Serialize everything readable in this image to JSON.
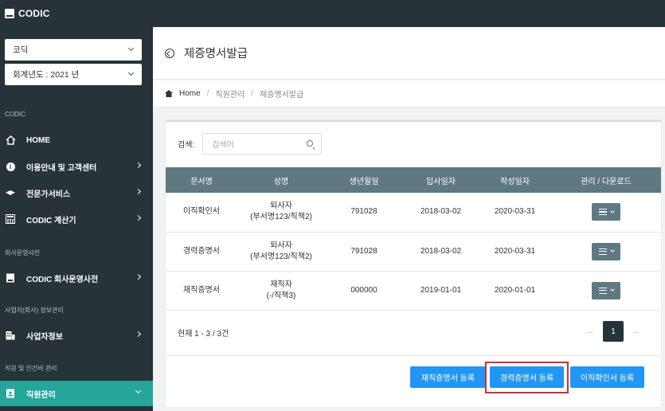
{
  "app": {
    "brand": "CODIC"
  },
  "sidebar": {
    "company_select": "코딕",
    "year_select": "회계년도 : 2021 년",
    "sections": [
      {
        "label": "CODIC"
      },
      {
        "label": "회사운영사전"
      },
      {
        "label": "사업자(회사) 정보관리"
      },
      {
        "label": "직원 및 인건비 관리"
      }
    ],
    "items": [
      {
        "label": "HOME",
        "icon": "home-icon"
      },
      {
        "label": "이용안내 및 고객센터",
        "icon": "info-icon"
      },
      {
        "label": "전문가서비스",
        "icon": "graduation-cap-icon"
      },
      {
        "label": "CODIC 계산기",
        "icon": "calculator-icon"
      },
      {
        "label": "CODIC 회사운영사전",
        "icon": "book-icon"
      },
      {
        "label": "사업자정보",
        "icon": "building-icon"
      },
      {
        "label": "직원관리",
        "icon": "id-card-icon"
      }
    ]
  },
  "page": {
    "title": "제증명서발급",
    "breadcrumb": [
      "Home",
      "직원관리",
      "제증명서발급"
    ]
  },
  "search": {
    "label": "검색:",
    "placeholder": "검색어"
  },
  "table": {
    "headers": [
      "문서명",
      "성명",
      "생년월일",
      "입사일자",
      "작성일자",
      "관리 / 다운로드"
    ],
    "rows": [
      {
        "doc": "이직확인서",
        "name": "퇴사자",
        "dept": "(부서명123/직책2)",
        "birth": "791028",
        "join": "2018-03-02",
        "written": "2020-03-31"
      },
      {
        "doc": "경력증명서",
        "name": "퇴사자",
        "dept": "(부서명123/직책2)",
        "birth": "791028",
        "join": "2018-03-02",
        "written": "2020-03-31"
      },
      {
        "doc": "재직증명서",
        "name": "재직자",
        "dept": "(-/직책3)",
        "birth": "000000",
        "join": "2019-01-01",
        "written": "2020-01-01"
      }
    ]
  },
  "pagination": {
    "summary": "현재 1 - 3 / 3건",
    "prev": "←",
    "current": "1",
    "next": "→"
  },
  "actions": {
    "employment_cert": "재직증명서 등록",
    "career_cert": "경력증명서 등록",
    "separation_cert": "이직확인서 등록"
  }
}
